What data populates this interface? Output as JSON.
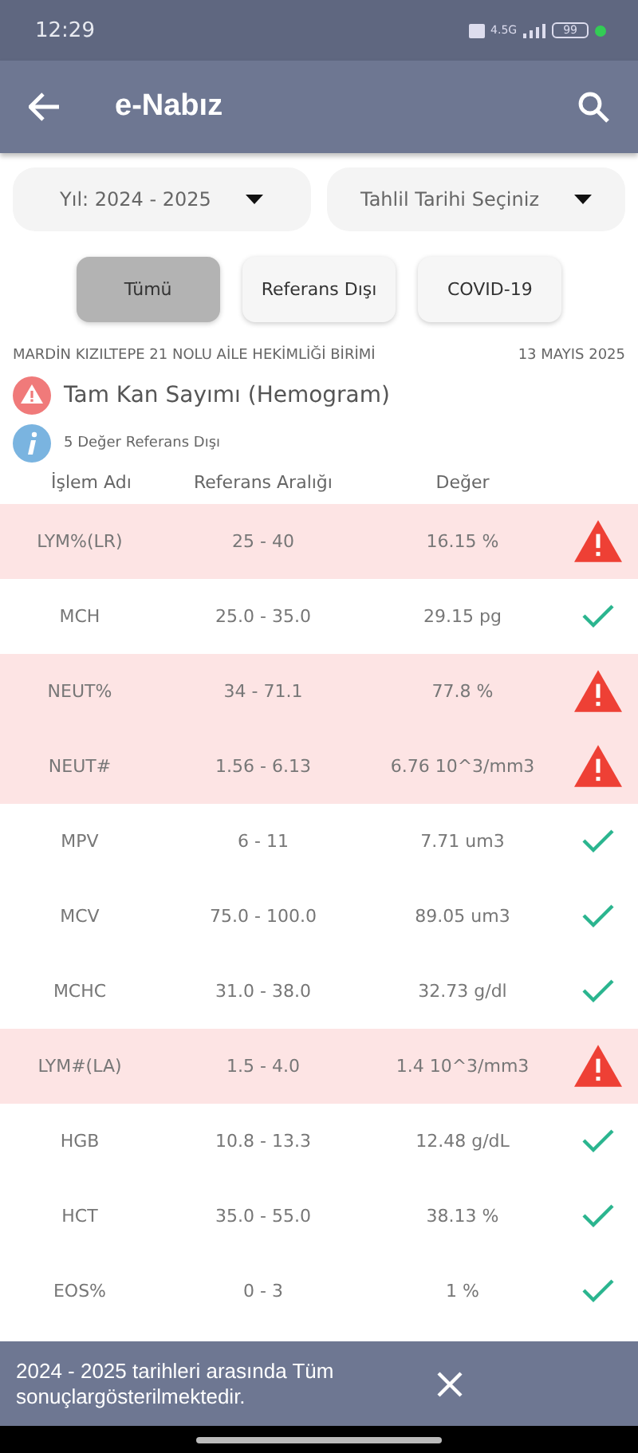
{
  "status_bar": {
    "time": "12:29",
    "network": "4.5G",
    "battery": "99"
  },
  "app_bar": {
    "title": "e-Nabız"
  },
  "dropdowns": [
    {
      "value": "Yıl: 2024 - 2025"
    },
    {
      "value": "Tahlil Tarihi Seçiniz"
    }
  ],
  "filters": [
    {
      "label": "Tümü",
      "selected": true
    },
    {
      "label": "Referans Dışı",
      "selected": false
    },
    {
      "label": "COVID-19",
      "selected": false
    }
  ],
  "report": {
    "facility": "MARDİN KIZILTEPE 21 NOLU AİLE HEKİMLİĞİ BİRİMİ",
    "date": "13 MAYIS 2025",
    "test_name": "Tam Kan Sayımı (Hemogram)",
    "summary": "5 Değer Referans Dışı"
  },
  "table": {
    "columns": [
      "İşlem Adı",
      "Referans Aralığı",
      "Değer"
    ],
    "rows": [
      {
        "name": "LYM%(LR)",
        "range": "25 - 40",
        "value": "16.15 %",
        "out_of_range": true
      },
      {
        "name": "MCH",
        "range": "25.0 - 35.0",
        "value": "29.15 pg",
        "out_of_range": false
      },
      {
        "name": "NEUT%",
        "range": "34 - 71.1",
        "value": "77.8 %",
        "out_of_range": true
      },
      {
        "name": "NEUT#",
        "range": "1.56 - 6.13",
        "value": "6.76 10^3/mm3",
        "out_of_range": true
      },
      {
        "name": "MPV",
        "range": "6 - 11",
        "value": "7.71 um3",
        "out_of_range": false
      },
      {
        "name": "MCV",
        "range": "75.0 - 100.0",
        "value": "89.05 um3",
        "out_of_range": false
      },
      {
        "name": "MCHC",
        "range": "31.0 - 38.0",
        "value": "32.73 g/dl",
        "out_of_range": false
      },
      {
        "name": "LYM#(LA)",
        "range": "1.5 - 4.0",
        "value": "1.4 10^3/mm3",
        "out_of_range": true
      },
      {
        "name": "HGB",
        "range": "10.8 - 13.3",
        "value": "12.48 g/dL",
        "out_of_range": false
      },
      {
        "name": "HCT",
        "range": "35.0 - 55.0",
        "value": "38.13 %",
        "out_of_range": false
      },
      {
        "name": "EOS%",
        "range": "0 - 3",
        "value": "1 %",
        "out_of_range": false
      }
    ]
  },
  "snackbar": {
    "message": "2024 - 2025 tarihleri arasında Tüm sonuçlargösterilmektedir."
  }
}
